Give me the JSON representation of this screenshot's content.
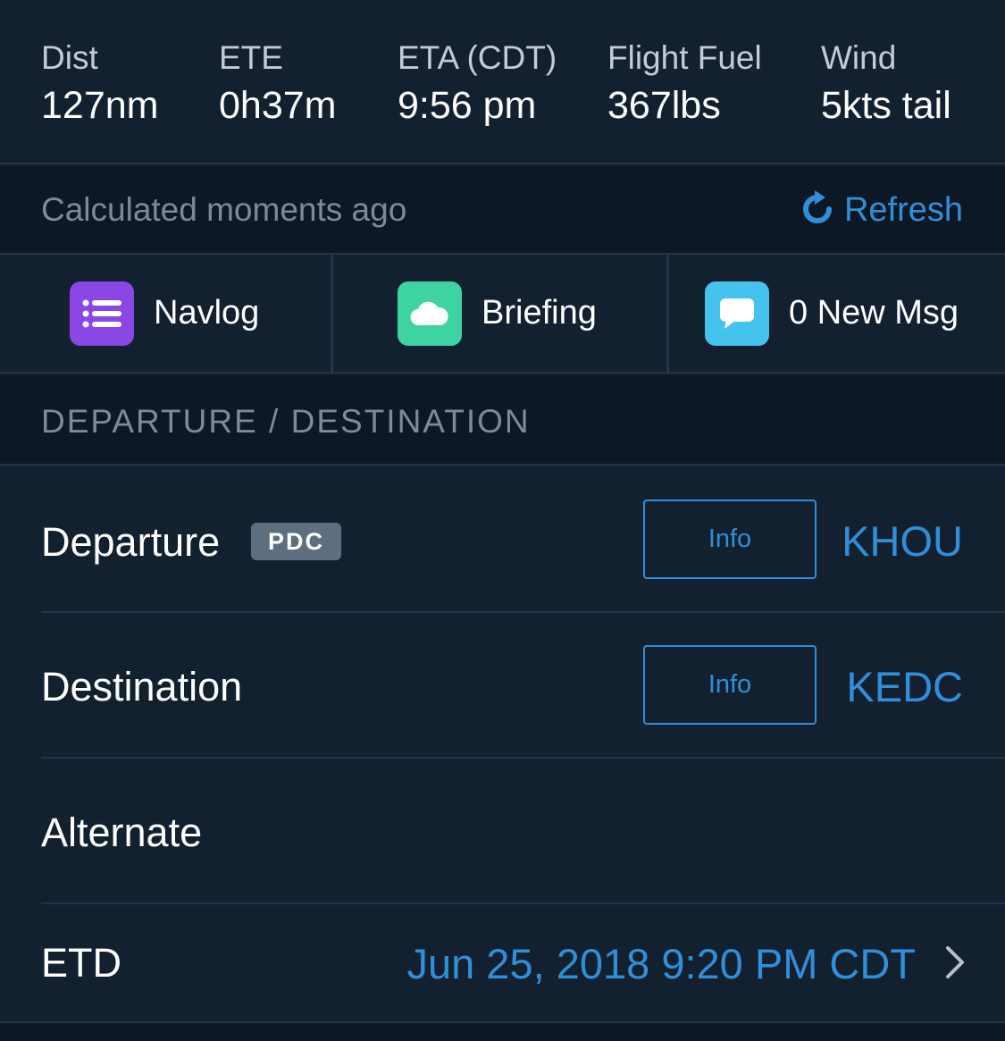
{
  "stats": [
    {
      "label": "Dist",
      "value": "127nm"
    },
    {
      "label": "ETE",
      "value": "0h37m"
    },
    {
      "label": "ETA (CDT)",
      "value": "9:56 pm"
    },
    {
      "label": "Flight Fuel",
      "value": "367lbs"
    },
    {
      "label": "Wind",
      "value": "5kts tail"
    }
  ],
  "status": {
    "calculated": "Calculated moments ago",
    "refresh_label": "Refresh",
    "refresh_icon": "refresh-icon"
  },
  "actions": [
    {
      "label": "Navlog",
      "icon": "list-icon",
      "color": "#8a47e6"
    },
    {
      "label": "Briefing",
      "icon": "cloud-icon",
      "color": "#3ed3a3"
    },
    {
      "label": "0 New Msg",
      "icon": "message-icon",
      "color": "#44c3ef"
    }
  ],
  "section": {
    "title": "DEPARTURE / DESTINATION"
  },
  "departure": {
    "label": "Departure",
    "badge": "PDC",
    "info_label": "Info",
    "code": "KHOU"
  },
  "destination": {
    "label": "Destination",
    "info_label": "Info",
    "code": "KEDC"
  },
  "alternate": {
    "label": "Alternate"
  },
  "etd": {
    "label": "ETD",
    "value": "Jun 25, 2018 9:20 PM CDT",
    "icon": "chevron-right-icon"
  },
  "colors": {
    "accent": "#2f8fd8",
    "background": "#132030",
    "header_background": "#0e1824",
    "muted_text": "#7d8a99",
    "badge": "#5f6e7e"
  }
}
